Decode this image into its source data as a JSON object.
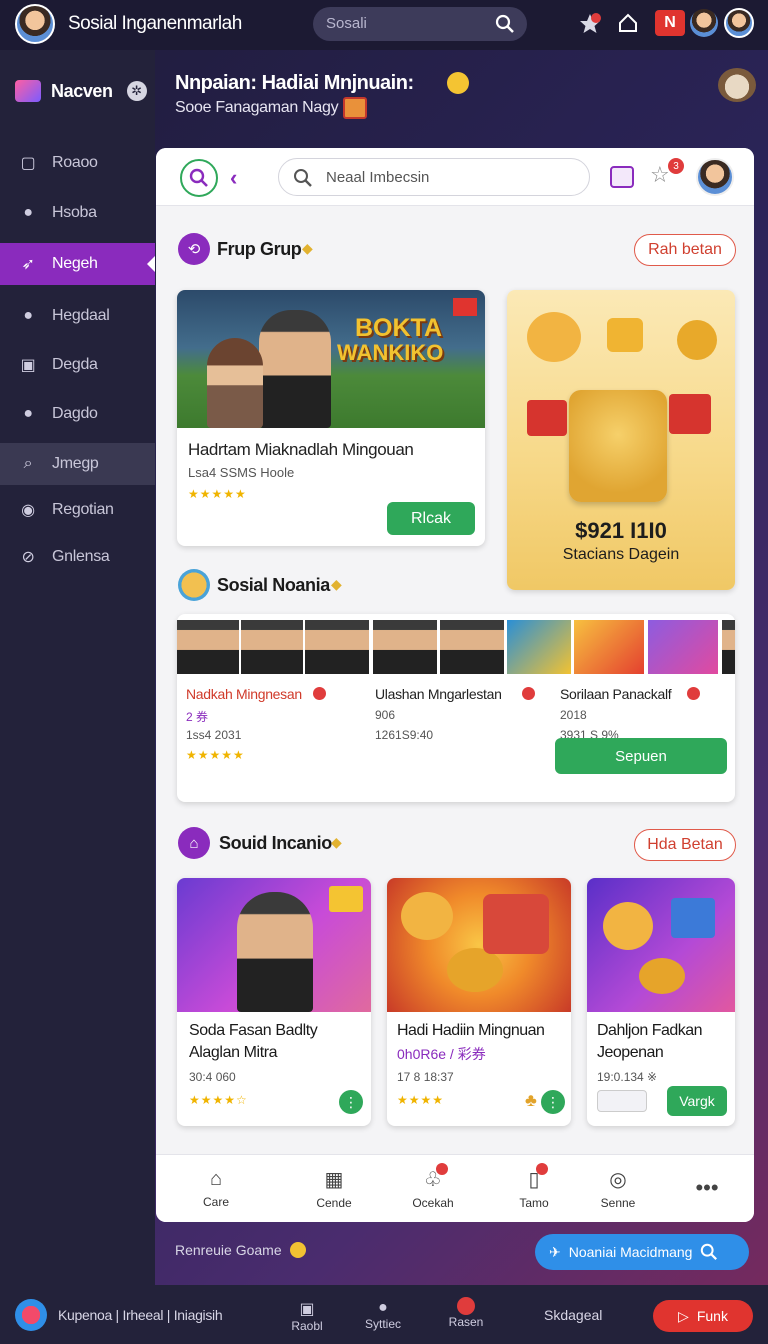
{
  "topbar": {
    "title": "Sosial Inganenmarlah",
    "search_placeholder": "Sosali",
    "badge": "N"
  },
  "sidebar": {
    "brand": "Nacven",
    "items": [
      {
        "label": "Roaoo",
        "icon": "square-icon"
      },
      {
        "label": "Hsoba",
        "icon": "user-icon"
      },
      {
        "label": "Negeh",
        "icon": "rocket-icon"
      },
      {
        "label": "Hegdaal",
        "icon": "users-icon"
      },
      {
        "label": "Degda",
        "icon": "file-icon"
      },
      {
        "label": "Dagdo",
        "icon": "user-icon"
      },
      {
        "label": "Jmegp",
        "icon": "search-icon"
      },
      {
        "label": "Regotian",
        "icon": "chat-icon"
      },
      {
        "label": "Gnlensa",
        "icon": "compass-icon"
      }
    ]
  },
  "hero": {
    "title": "Nnpaian: Hadiai Mnjnuain:",
    "subtitle": "Sooe Fanagaman Nagy"
  },
  "panel": {
    "search_placeholder": "Neaal Imbecsin",
    "notif_count": "3"
  },
  "section1": {
    "title": "Frup Grup",
    "pill": "Rah betan",
    "featured": {
      "banner_line1": "BOKTA",
      "banner_line2": "WANKIKO",
      "title": "Hadrtam Miaknadlah Mingouan",
      "meta": "Lsa4 SSMS Hoole",
      "button": "Rlcak"
    },
    "promo": {
      "amount": "$921 I1I0",
      "label": "Stacians Dagein"
    }
  },
  "section2": {
    "title": "Sosial Noania",
    "button": "Sepuen",
    "items": [
      {
        "name": "Nadkah Mingnesan",
        "line1": "2 券",
        "line2": "1ss4 2031"
      },
      {
        "name": "Ulashan Mngarlestan",
        "line1": "906",
        "line2": "1261S9:40"
      },
      {
        "name": "Sorilaan Panackalf",
        "line1": "2018",
        "line2": "3931 S 9%"
      }
    ]
  },
  "section3": {
    "title": "Souid Incanio",
    "pill": "Hda Betan",
    "cards": [
      {
        "title1": "Soda Fasan Badlty",
        "title2": "Alaglan Mitra",
        "meta": "30:4 060",
        "button": ""
      },
      {
        "title1": "Hadi Hadiin Mingnuan",
        "title2": "0h0R6e / 彩券",
        "meta": "17 8 18:37",
        "button": ""
      },
      {
        "title1": "Dahljon Fadkan",
        "title2": "Jeopenan",
        "meta": "19:0.134 ※",
        "button": "Vargk"
      }
    ]
  },
  "bottom_nav": [
    {
      "label": "Care",
      "icon": "home-icon"
    },
    {
      "label": "Cende",
      "icon": "grid-icon"
    },
    {
      "label": "Ocekah",
      "icon": "bell-icon"
    },
    {
      "label": "Tamo",
      "icon": "doc-icon"
    },
    {
      "label": "Senne",
      "icon": "target-icon"
    },
    {
      "label": "",
      "icon": "more-icon"
    }
  ],
  "footer": {
    "left_text": "Renreuie Goame",
    "search_button": "Noaniai Macidmang"
  },
  "bottombar": {
    "links": "Kupenoa | Irheeal | Iniagisih",
    "items": [
      {
        "label": "Raobl"
      },
      {
        "label": "Syttiec"
      },
      {
        "label": "Rasen"
      }
    ],
    "right_text": "Skdageal",
    "cta": "Funk"
  },
  "colors": {
    "accent": "#8a2bbd",
    "green": "#2fa85a",
    "red": "#e03c3c",
    "sidebar": "#23223a"
  }
}
